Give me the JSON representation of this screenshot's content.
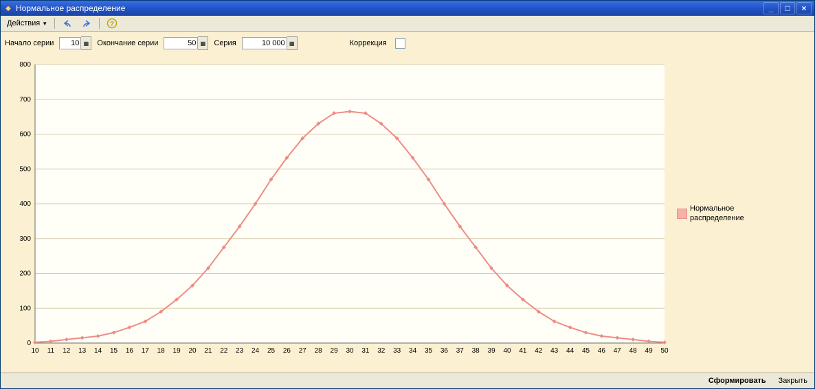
{
  "window": {
    "title": "Нормальное распределение"
  },
  "toolbar": {
    "actions_label": "Действия"
  },
  "form": {
    "start_label": "Начало серии",
    "start_value": "10",
    "end_label": "Окончание серии",
    "end_value": "50",
    "series_label": "Серия",
    "series_value": "10 000",
    "correction_label": "Коррекция",
    "correction_checked": false
  },
  "chart_data": {
    "type": "line",
    "xlabel": "",
    "ylabel": "",
    "ylim": [
      0,
      800
    ],
    "y_ticks": [
      0,
      100,
      200,
      300,
      400,
      500,
      600,
      700,
      800
    ],
    "categories": [
      10,
      11,
      12,
      13,
      14,
      15,
      16,
      17,
      18,
      19,
      20,
      21,
      22,
      23,
      24,
      25,
      26,
      27,
      28,
      29,
      30,
      31,
      32,
      33,
      34,
      35,
      36,
      37,
      38,
      39,
      40,
      41,
      42,
      43,
      44,
      45,
      46,
      47,
      48,
      49,
      50
    ],
    "series": [
      {
        "name": "Нормальное распределение",
        "values": [
          2,
          5,
          10,
          15,
          20,
          30,
          45,
          62,
          90,
          125,
          165,
          215,
          275,
          335,
          400,
          470,
          532,
          588,
          630,
          660,
          665,
          660,
          630,
          588,
          532,
          470,
          400,
          335,
          275,
          215,
          165,
          125,
          90,
          62,
          45,
          30,
          20,
          15,
          10,
          5,
          2
        ],
        "color": "#ec8d83"
      }
    ]
  },
  "legend": {
    "label": "Нормальное\nраспределение"
  },
  "footer": {
    "generate_label": "Сформировать",
    "close_label": "Закрыть"
  }
}
